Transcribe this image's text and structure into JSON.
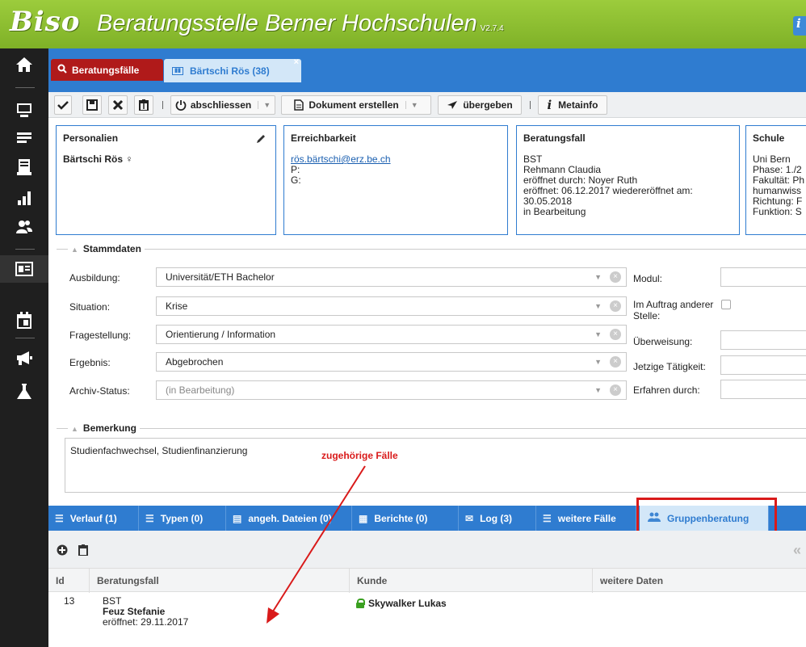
{
  "header": {
    "logo": "Biso",
    "title": "Beratungsstelle Berner Hochschulen",
    "version": "V2.7.4",
    "info_icon": "i"
  },
  "sidebar": {
    "icons": [
      "home-icon",
      "monitor-icon",
      "list-icon",
      "archive-icon",
      "chart-icon",
      "users-icon",
      "id-card-icon",
      "calendar-icon",
      "megaphone-icon",
      "flask-icon"
    ]
  },
  "tabs": [
    {
      "label": "Beratungsfälle",
      "icon": "search-icon"
    },
    {
      "label": "Bärtschi Rös (38)",
      "icon": "id-card-icon",
      "close": "×"
    }
  ],
  "toolbar": {
    "abschliessen": "abschliessen",
    "dokument": "Dokument erstellen",
    "uebergeben": "übergeben",
    "metainfo": "Metainfo"
  },
  "cards": {
    "personalien": {
      "title": "Personalien",
      "name": "Bärtschi Rös ♀"
    },
    "erreichbarkeit": {
      "title": "Erreichbarkeit",
      "email": "rös.bärtschi@erz.be.ch",
      "p": "P:",
      "g": "G:"
    },
    "beratungsfall": {
      "title": "Beratungsfall",
      "l1": "BST",
      "l2": "Rehmann Claudia",
      "l3": "eröffnet durch: Noyer Ruth",
      "l4": "eröffnet: 06.12.2017 wiedereröffnet am:",
      "l5": "30.05.2018",
      "l6": "in Bearbeitung"
    },
    "schule": {
      "title": "Schule",
      "l1": "Uni Bern",
      "l2": "Phase: 1./2",
      "l3": "Fakultät: Ph",
      "l4": "humanwiss",
      "l5": "Richtung: F",
      "l6": "Funktion: S"
    }
  },
  "stammdaten": {
    "legend": "Stammdaten",
    "ausbildung": {
      "label": "Ausbildung:",
      "value": "Universität/ETH Bachelor"
    },
    "situation": {
      "label": "Situation:",
      "value": "Krise"
    },
    "fragestellung": {
      "label": "Fragestellung:",
      "value": "Orientierung / Information"
    },
    "ergebnis": {
      "label": "Ergebnis:",
      "value": "Abgebrochen"
    },
    "archiv": {
      "label": "Archiv-Status:",
      "value": "(in Bearbeitung)"
    },
    "modul": "Modul:",
    "auftrag": "Im Auftrag anderer Stelle:",
    "ueberweisung": "Überweisung:",
    "taetigkeit": "Jetzige Tätigkeit:",
    "erfahren": "Erfahren durch:"
  },
  "bemerkung": {
    "legend": "Bemerkung",
    "text": "Studienfachwechsel, Studienfinanzierung",
    "annotation": "zugehörige Fälle"
  },
  "bottom_tabs": [
    "Verlauf (1)",
    "Typen (0)",
    "angeh. Dateien (0)",
    "Berichte (0)",
    "Log (3)",
    "weitere Fälle",
    "Gruppenberatung"
  ],
  "table": {
    "headers": [
      "Id",
      "Beratungsfall",
      "Kunde",
      "weitere Daten"
    ],
    "rows": [
      {
        "id": "13",
        "fall1": "BST",
        "fall2": "Feuz Stefanie",
        "fall3": "eröffnet: 29.11.2017",
        "kunde": "Skywalker Lukas"
      }
    ]
  }
}
